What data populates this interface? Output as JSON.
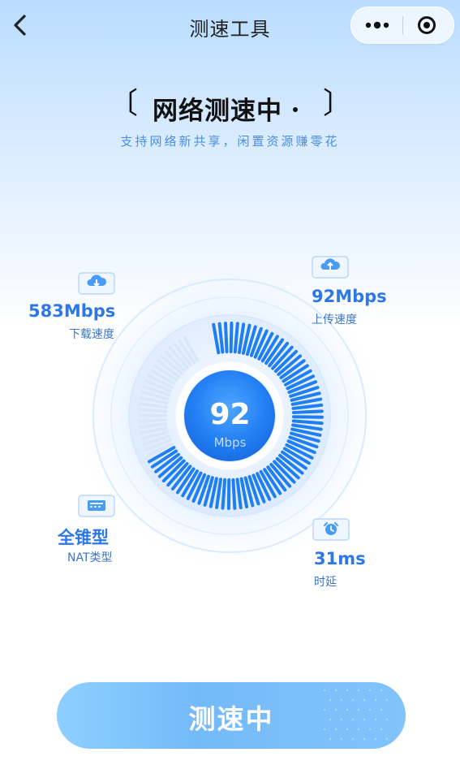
{
  "header": {
    "title": "测速工具"
  },
  "hero": {
    "left_bracket": "〔",
    "title": "网络测速中",
    "right_bracket": "〕",
    "subtitle": "支持网络新共享，闲置资源赚零花"
  },
  "metrics": {
    "download": {
      "value": "583Mbps",
      "label": "下载速度",
      "icon": "download-cloud-icon"
    },
    "upload": {
      "value": "92Mbps",
      "label": "上传速度",
      "icon": "upload-cloud-icon"
    },
    "nat": {
      "value": "全锥型",
      "label": "NAT类型",
      "icon": "router-icon"
    },
    "latency": {
      "value": "31ms",
      "label": "时延",
      "icon": "alarm-clock-icon"
    }
  },
  "gauge": {
    "value": "92",
    "unit": "Mbps",
    "accent": "#2d78e6",
    "ring_color": "#1e7ef2",
    "progress_fraction": 0.74
  },
  "action": {
    "label": "测速中"
  }
}
